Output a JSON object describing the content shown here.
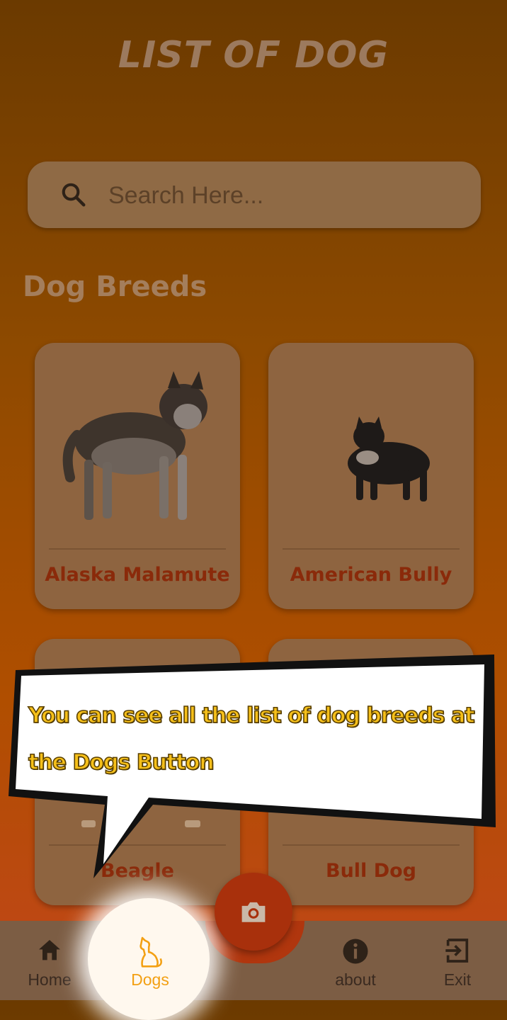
{
  "header": {
    "title": "LIST OF DOG"
  },
  "search": {
    "placeholder": "Search Here..."
  },
  "section": {
    "title": "Dog Breeds"
  },
  "breeds": [
    {
      "name": "Alaska Malamute"
    },
    {
      "name": "American Bully"
    },
    {
      "name": "Beagle"
    },
    {
      "name": "Bull Dog"
    }
  ],
  "tooltip": {
    "line1": "You can see all the list of dog breeds at",
    "line2": "the Dogs Button"
  },
  "nav": {
    "items": [
      {
        "label": "Home",
        "icon": "home-icon"
      },
      {
        "label": "Dogs",
        "icon": "dog-icon",
        "active": true
      },
      {
        "label": "about",
        "icon": "info-icon"
      },
      {
        "label": "Exit",
        "icon": "exit-icon"
      }
    ],
    "center_button_icon": "camera-icon"
  },
  "colors": {
    "accent": "#c2461a",
    "active_nav": "#f3a013",
    "tooltip_text": "#f6c01a"
  }
}
